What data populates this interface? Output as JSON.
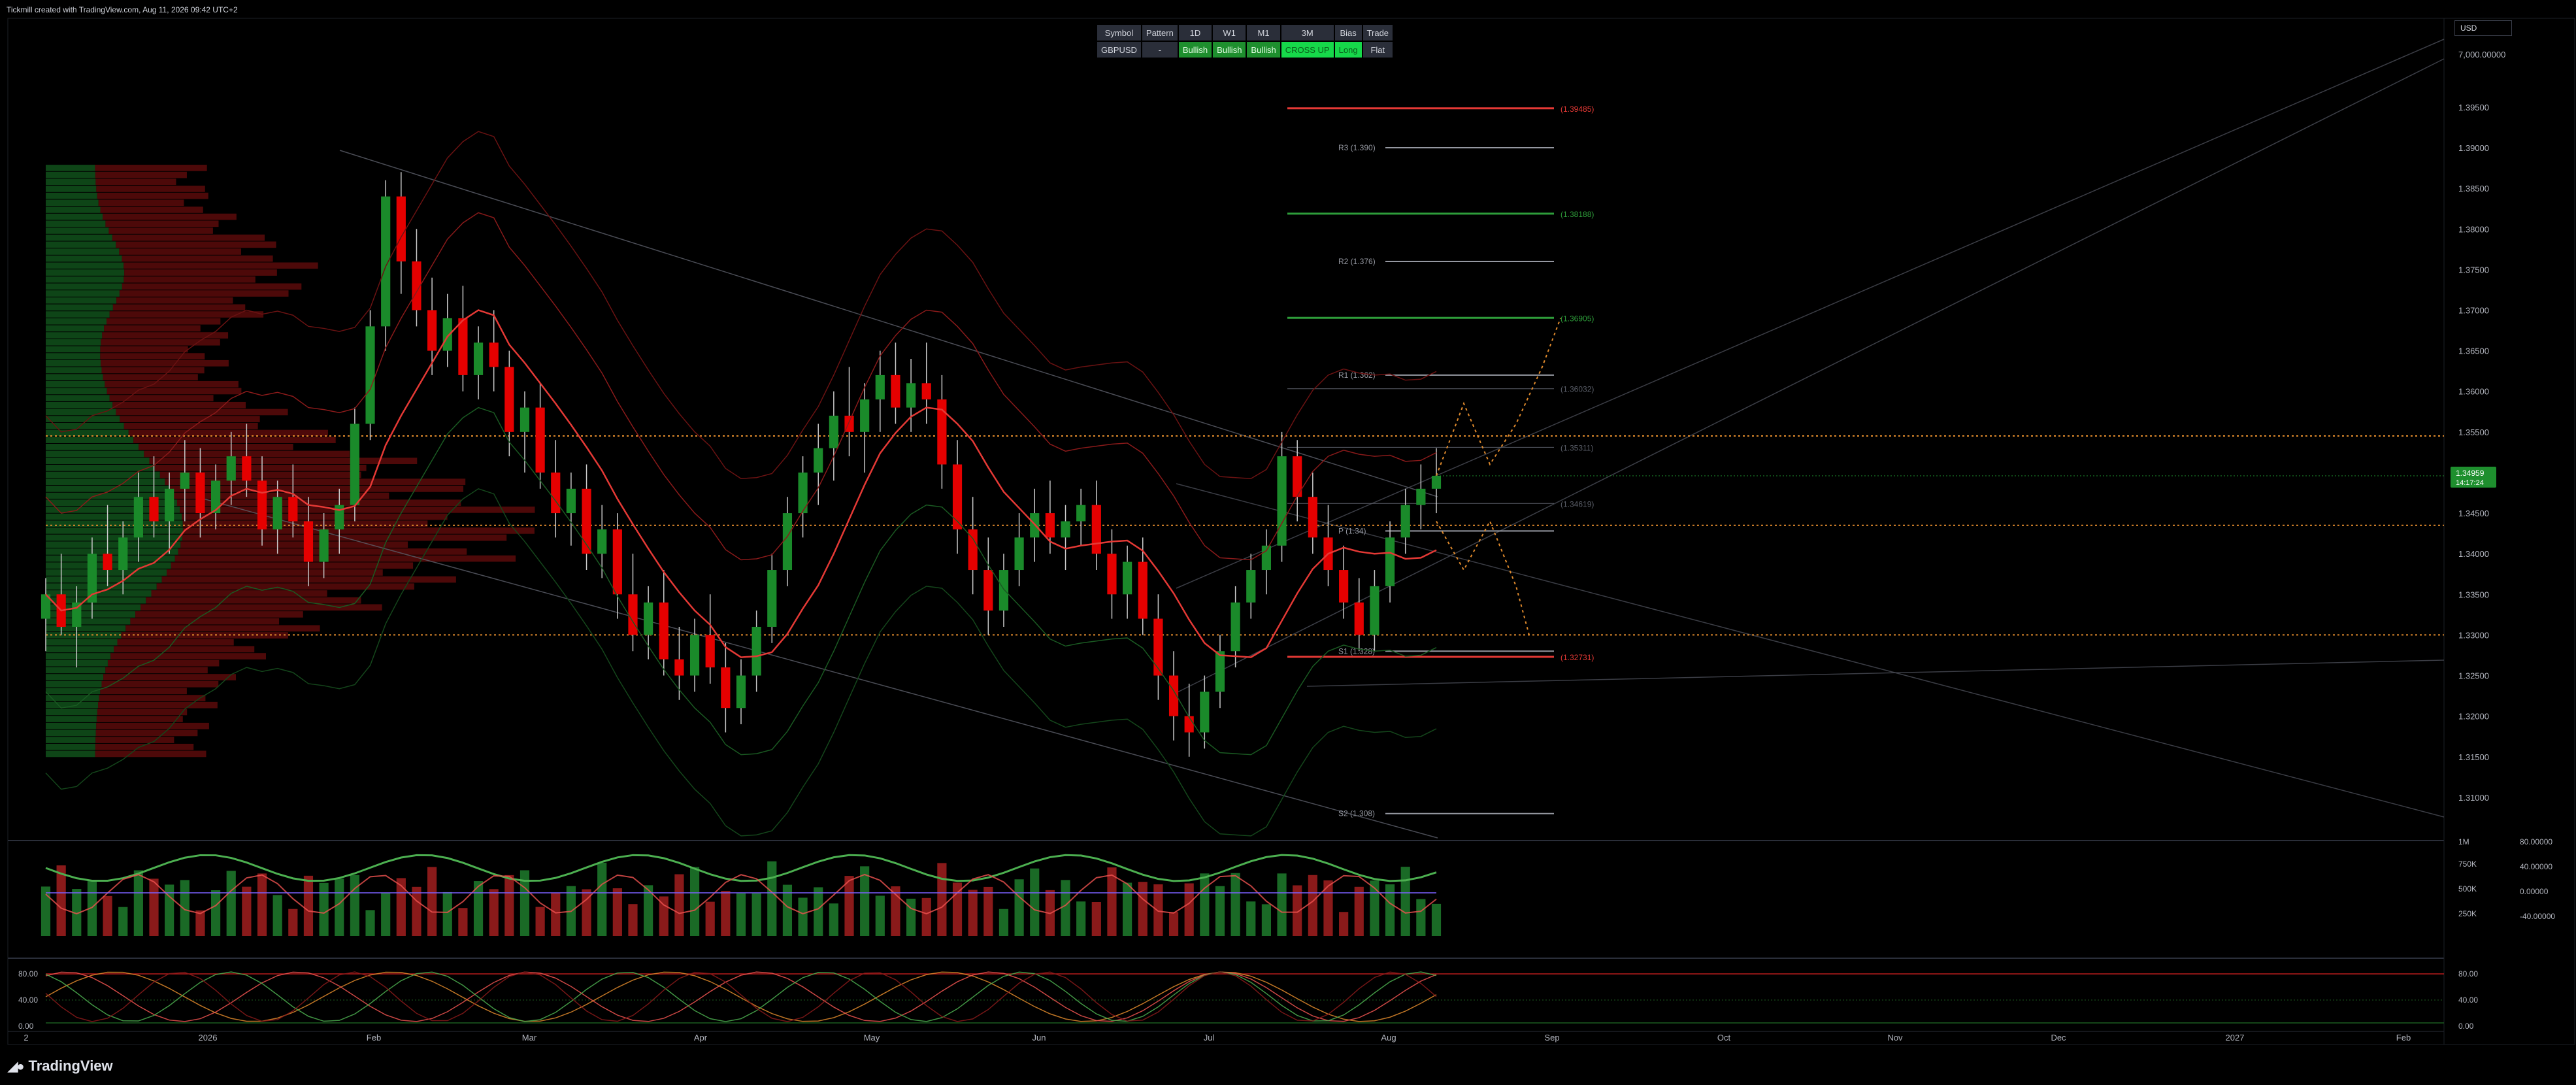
{
  "header": {
    "title": "Tickmill created with TradingView.com, Aug 11, 2026 09:42 UTC+2"
  },
  "footer": {
    "brand": "TradingView"
  },
  "currency": {
    "label": "USD"
  },
  "signal_table": {
    "headers": [
      "Symbol",
      "Pattern",
      "1D",
      "W1",
      "M1",
      "3M",
      "Bias",
      "Trade"
    ],
    "row": [
      "GBPUSD",
      "-",
      "Bullish",
      "Bullish",
      "Bullish",
      "CROSS UP",
      "Long",
      "Flat"
    ]
  },
  "colors": {
    "bull": "#1a8a2a",
    "bear": "#e50000",
    "background": "#000000",
    "price_badge": "#1e8f2e"
  },
  "chart_data": [
    {
      "type": "candlestick",
      "symbol": "GBPUSD",
      "timeframe": "1D",
      "ylim": [
        1.305,
        1.3995
      ],
      "y_ticks": [
        "1.39500",
        "1.39000",
        "1.38500",
        "1.38000",
        "1.37500",
        "1.37000",
        "1.36500",
        "1.36000",
        "1.35500",
        "1.35000",
        "1.34500",
        "1.34000",
        "1.33500",
        "1.33000",
        "1.32500",
        "1.32000",
        "1.31500",
        "1.31000"
      ],
      "top_tick_label": "7,000.00000",
      "x_ticks": [
        "2",
        "2026",
        "Feb",
        "Mar",
        "Apr",
        "May",
        "Jun",
        "Jul",
        "Aug",
        "Sep",
        "Oct",
        "Nov",
        "Dec",
        "2027",
        "Feb"
      ],
      "last_price": "1.34959",
      "countdown": "14:17:24",
      "pivot_levels": [
        {
          "label": "R3 (1.390)",
          "value": 1.39
        },
        {
          "label": "R2 (1.376)",
          "value": 1.376
        },
        {
          "label": "R1 (1.362)",
          "value": 1.362
        },
        {
          "label": "P (1.34)",
          "value": 1.3428
        },
        {
          "label": "S1 (1.328)",
          "value": 1.328
        },
        {
          "label": "S2 (1.308)",
          "value": 1.308
        }
      ],
      "price_levels": [
        {
          "label": "(1.39485)",
          "value": 1.39485,
          "color": "red"
        },
        {
          "label": "(1.38188)",
          "value": 1.38188,
          "color": "green"
        },
        {
          "label": "(1.36905)",
          "value": 1.36905,
          "color": "green"
        },
        {
          "label": "(1.36032)",
          "value": 1.36032,
          "color": "dim"
        },
        {
          "label": "(1.35311)",
          "value": 1.35311,
          "color": "dim"
        },
        {
          "label": "(1.34619)",
          "value": 1.34619,
          "color": "dim"
        },
        {
          "label": "(1.32731)",
          "value": 1.32731,
          "color": "red"
        }
      ],
      "dotted_levels": [
        1.3545,
        1.3435,
        1.33
      ],
      "ohlc": [
        [
          1.332,
          1.337,
          1.328,
          1.335
        ],
        [
          1.335,
          1.34,
          1.33,
          1.331
        ],
        [
          1.331,
          1.336,
          1.326,
          1.334
        ],
        [
          1.334,
          1.342,
          1.332,
          1.34
        ],
        [
          1.34,
          1.346,
          1.336,
          1.338
        ],
        [
          1.338,
          1.344,
          1.335,
          1.342
        ],
        [
          1.342,
          1.35,
          1.339,
          1.347
        ],
        [
          1.347,
          1.352,
          1.342,
          1.344
        ],
        [
          1.344,
          1.35,
          1.34,
          1.348
        ],
        [
          1.348,
          1.354,
          1.344,
          1.35
        ],
        [
          1.35,
          1.353,
          1.342,
          1.345
        ],
        [
          1.345,
          1.351,
          1.343,
          1.349
        ],
        [
          1.349,
          1.355,
          1.346,
          1.352
        ],
        [
          1.352,
          1.356,
          1.347,
          1.349
        ],
        [
          1.349,
          1.352,
          1.341,
          1.343
        ],
        [
          1.343,
          1.349,
          1.34,
          1.347
        ],
        [
          1.347,
          1.351,
          1.342,
          1.344
        ],
        [
          1.344,
          1.347,
          1.336,
          1.339
        ],
        [
          1.339,
          1.345,
          1.337,
          1.343
        ],
        [
          1.343,
          1.348,
          1.34,
          1.346
        ],
        [
          1.346,
          1.358,
          1.344,
          1.356
        ],
        [
          1.356,
          1.37,
          1.354,
          1.368
        ],
        [
          1.368,
          1.386,
          1.365,
          1.384
        ],
        [
          1.384,
          1.387,
          1.372,
          1.376
        ],
        [
          1.376,
          1.38,
          1.368,
          1.37
        ],
        [
          1.37,
          1.374,
          1.362,
          1.365
        ],
        [
          1.365,
          1.372,
          1.363,
          1.369
        ],
        [
          1.369,
          1.373,
          1.36,
          1.362
        ],
        [
          1.362,
          1.368,
          1.359,
          1.366
        ],
        [
          1.366,
          1.37,
          1.36,
          1.363
        ],
        [
          1.363,
          1.365,
          1.352,
          1.355
        ],
        [
          1.355,
          1.36,
          1.35,
          1.358
        ],
        [
          1.358,
          1.361,
          1.348,
          1.35
        ],
        [
          1.35,
          1.354,
          1.342,
          1.345
        ],
        [
          1.345,
          1.35,
          1.341,
          1.348
        ],
        [
          1.348,
          1.351,
          1.338,
          1.34
        ],
        [
          1.34,
          1.346,
          1.337,
          1.343
        ],
        [
          1.343,
          1.345,
          1.332,
          1.335
        ],
        [
          1.335,
          1.34,
          1.328,
          1.33
        ],
        [
          1.33,
          1.336,
          1.327,
          1.334
        ],
        [
          1.334,
          1.338,
          1.325,
          1.327
        ],
        [
          1.327,
          1.331,
          1.322,
          1.325
        ],
        [
          1.325,
          1.332,
          1.323,
          1.33
        ],
        [
          1.33,
          1.335,
          1.324,
          1.326
        ],
        [
          1.326,
          1.329,
          1.318,
          1.321
        ],
        [
          1.321,
          1.327,
          1.319,
          1.325
        ],
        [
          1.325,
          1.333,
          1.323,
          1.331
        ],
        [
          1.331,
          1.34,
          1.329,
          1.338
        ],
        [
          1.338,
          1.347,
          1.336,
          1.345
        ],
        [
          1.345,
          1.352,
          1.342,
          1.35
        ],
        [
          1.35,
          1.356,
          1.346,
          1.353
        ],
        [
          1.353,
          1.36,
          1.349,
          1.357
        ],
        [
          1.357,
          1.363,
          1.352,
          1.355
        ],
        [
          1.355,
          1.361,
          1.35,
          1.359
        ],
        [
          1.359,
          1.365,
          1.355,
          1.362
        ],
        [
          1.362,
          1.366,
          1.356,
          1.358
        ],
        [
          1.358,
          1.364,
          1.355,
          1.361
        ],
        [
          1.361,
          1.366,
          1.356,
          1.359
        ],
        [
          1.359,
          1.362,
          1.348,
          1.351
        ],
        [
          1.351,
          1.354,
          1.34,
          1.343
        ],
        [
          1.343,
          1.347,
          1.335,
          1.338
        ],
        [
          1.338,
          1.342,
          1.33,
          1.333
        ],
        [
          1.333,
          1.34,
          1.331,
          1.338
        ],
        [
          1.338,
          1.345,
          1.336,
          1.342
        ],
        [
          1.342,
          1.348,
          1.339,
          1.345
        ],
        [
          1.345,
          1.349,
          1.34,
          1.342
        ],
        [
          1.342,
          1.346,
          1.338,
          1.344
        ],
        [
          1.344,
          1.348,
          1.341,
          1.346
        ],
        [
          1.346,
          1.349,
          1.338,
          1.34
        ],
        [
          1.34,
          1.343,
          1.332,
          1.335
        ],
        [
          1.335,
          1.341,
          1.332,
          1.339
        ],
        [
          1.339,
          1.342,
          1.33,
          1.332
        ],
        [
          1.332,
          1.335,
          1.322,
          1.325
        ],
        [
          1.325,
          1.328,
          1.317,
          1.32
        ],
        [
          1.32,
          1.324,
          1.315,
          1.318
        ],
        [
          1.318,
          1.325,
          1.316,
          1.323
        ],
        [
          1.323,
          1.33,
          1.321,
          1.328
        ],
        [
          1.328,
          1.336,
          1.326,
          1.334
        ],
        [
          1.334,
          1.34,
          1.332,
          1.338
        ],
        [
          1.338,
          1.343,
          1.335,
          1.341
        ],
        [
          1.341,
          1.355,
          1.339,
          1.352
        ],
        [
          1.352,
          1.354,
          1.344,
          1.347
        ],
        [
          1.347,
          1.35,
          1.34,
          1.342
        ],
        [
          1.342,
          1.346,
          1.336,
          1.338
        ],
        [
          1.338,
          1.341,
          1.332,
          1.334
        ],
        [
          1.334,
          1.337,
          1.328,
          1.33
        ],
        [
          1.33,
          1.338,
          1.328,
          1.336
        ],
        [
          1.336,
          1.344,
          1.334,
          1.342
        ],
        [
          1.342,
          1.348,
          1.34,
          1.346
        ],
        [
          1.346,
          1.351,
          1.343,
          1.348
        ],
        [
          1.348,
          1.353,
          1.345,
          1.3496
        ]
      ]
    },
    {
      "type": "bar",
      "name": "volume",
      "right_ticks": [
        "750K",
        "500K",
        "250K"
      ],
      "right_ticks_2": [
        "40.00000",
        "0.00000",
        "-40.00000"
      ],
      "top_labels": [
        "1M",
        "80.00000"
      ]
    },
    {
      "type": "line",
      "name": "oscillator",
      "ylim": [
        0,
        100
      ],
      "left_ticks": [
        "80.00",
        "40.00",
        "0.00"
      ],
      "right_ticks": [
        "80.00",
        "40.00",
        "0.00"
      ]
    }
  ]
}
